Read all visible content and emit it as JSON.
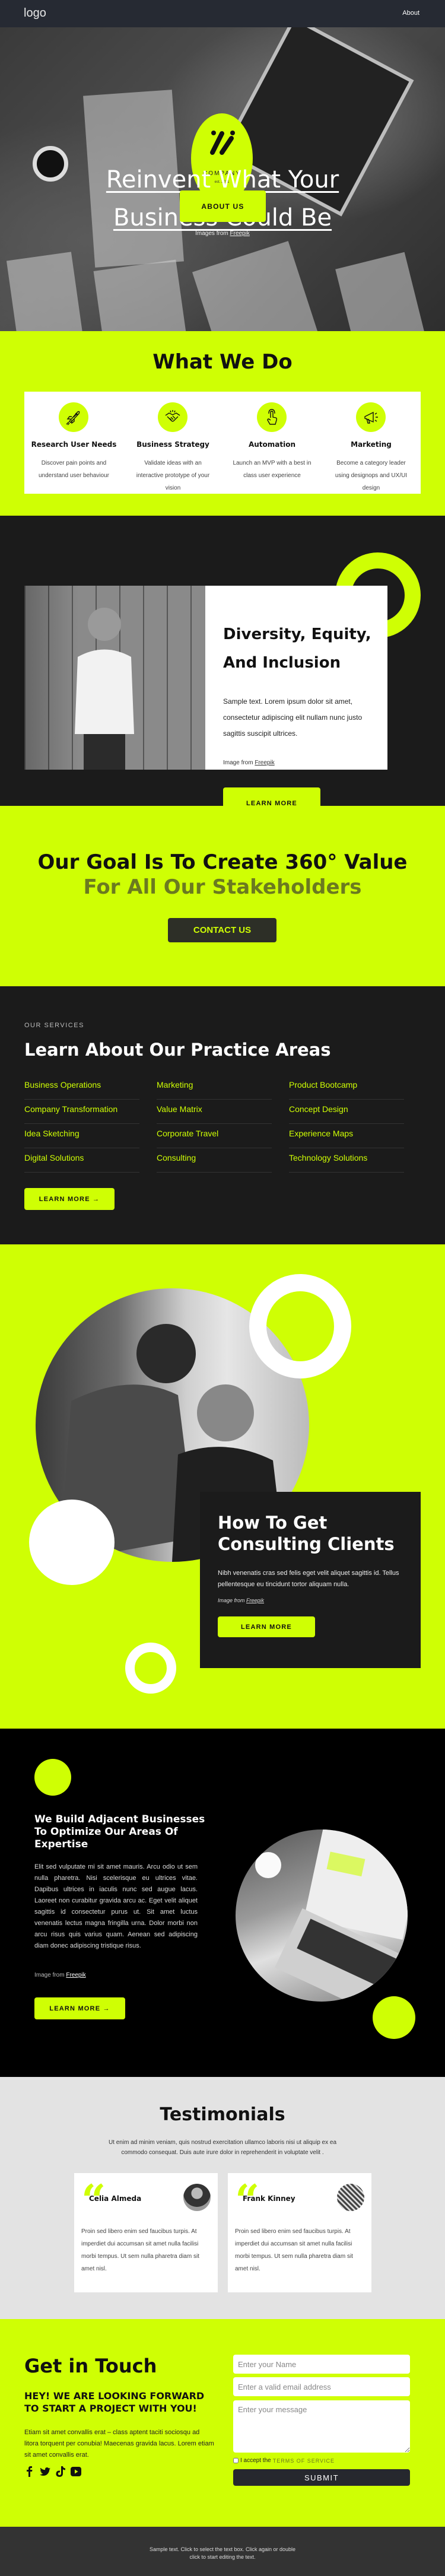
{
  "header": {
    "logo": "logo",
    "nav": [
      {
        "label": "About"
      }
    ]
  },
  "hero": {
    "badge": {
      "name": "COMPANY",
      "est": "est. 2021"
    },
    "title_line1": "Reinvent What Your",
    "title_line2": "Business Could Be",
    "button": "ABOUT US",
    "credit_prefix": "Images from ",
    "credit_link": "Freepik"
  },
  "what_we_do": {
    "title": "What We Do",
    "items": [
      {
        "icon": "rocket-icon",
        "title": "Research User Needs",
        "desc": "Discover pain points and understand user behaviour"
      },
      {
        "icon": "handshake-icon",
        "title": "Business Strategy",
        "desc": "Validate ideas with an interactive prototype of your vision"
      },
      {
        "icon": "touch-icon",
        "title": "Automation",
        "desc": "Launch an MVP with a best in class user experience"
      },
      {
        "icon": "megaphone-icon",
        "title": "Marketing",
        "desc": "Become a category leader using designops and UX/UI design"
      }
    ]
  },
  "diversity": {
    "title": "Diversity, Equity, And Inclusion",
    "text": "Sample text. Lorem ipsum dolor sit amet, consectetur adipiscing elit nullam nunc justo sagittis suscipit ultrices.",
    "credit_prefix": "Image from ",
    "credit_link": "Freepik",
    "button": "LEARN MORE"
  },
  "goal": {
    "line1": "Our Goal Is To Create 360° Value",
    "line2": "For All Our Stakeholders",
    "button": "CONTACT US"
  },
  "practice": {
    "eyebrow": "OUR SERVICES",
    "title": "Learn About Our Practice Areas",
    "columns": [
      [
        "Business Operations",
        "Company Transformation",
        "Idea Sketching",
        "Digital Solutions"
      ],
      [
        "Marketing",
        "Value Matrix",
        "Corporate Travel",
        "Consulting"
      ],
      [
        "Product Bootcamp",
        "Concept Design",
        "Experience Maps",
        "Technology Solutions"
      ]
    ],
    "button": "LEARN MORE →"
  },
  "consulting": {
    "title": "How To Get Consulting Clients",
    "text": "Nibh venenatis cras sed felis eget velit aliquet sagittis id. Tellus pellentesque eu tincidunt tortor aliquam nulla.",
    "credit_prefix": "Image from ",
    "credit_link": "Freepik",
    "button": "LEARN MORE"
  },
  "adjacent": {
    "title": "We Build Adjacent Businesses To Optimize Our Areas Of Expertise",
    "text": "Elit sed vulputate mi sit amet mauris. Arcu odio ut sem nulla pharetra. Nisi scelerisque eu ultrices vitae. Dapibus ultrices in iaculis nunc sed augue lacus. Laoreet non curabitur gravida arcu ac. Eget velit aliquet sagittis id consectetur purus ut. Sit amet luctus venenatis lectus magna fringilla urna. Dolor morbi non arcu risus quis varius quam. Aenean sed adipiscing diam donec adipiscing tristique risus.",
    "credit_prefix": "Image from ",
    "credit_link": "Freepik",
    "button": "LEARN MORE →"
  },
  "testimonials": {
    "title": "Testimonials",
    "subtitle": "Ut enim ad minim veniam, quis nostrud exercitation ullamco laboris nisi ut aliquip ex ea commodo consequat. Duis aute irure dolor in reprehenderit in voluptate velit .",
    "items": [
      {
        "name": "Celia Almeda",
        "text": "Proin sed libero enim sed faucibus turpis. At imperdiet dui accumsan sit amet nulla facilisi morbi tempus. Ut sem nulla pharetra diam sit amet nisl."
      },
      {
        "name": "Frank Kinney",
        "text": "Proin sed libero enim sed faucibus turpis. At imperdiet dui accumsan sit amet nulla facilisi morbi tempus. Ut sem nulla pharetra diam sit amet nisl."
      }
    ]
  },
  "contact": {
    "title": "Get in Touch",
    "subtitle": "HEY! WE ARE LOOKING FORWARD TO START A PROJECT WITH YOU!",
    "text": "Etiam sit amet convallis erat – class aptent taciti sociosqu ad litora torquent per conubia! Maecenas gravida lacus. Lorem etiam sit amet convallis erat.",
    "socials": [
      "facebook-icon",
      "twitter-icon",
      "tiktok-icon",
      "youtube-icon"
    ],
    "form": {
      "name_placeholder": "Enter your Name",
      "name_value": "",
      "email_placeholder": "Enter a valid email address",
      "email_value": "",
      "message_placeholder": "Enter your message",
      "message_value": "",
      "terms_prefix": "I accept the ",
      "terms_link": "TERMS OF SERVICE",
      "terms_checked": false,
      "submit": "SUBMIT"
    }
  },
  "footer": {
    "text": "Sample text. Click to select the text box. Click again or double click to start editing the text."
  },
  "colors": {
    "accent": "#cfff04",
    "dark": "#1b1b1b",
    "header": "#262a33",
    "olive": "#6b7a20",
    "footer": "#333333",
    "light_gray": "#e3e3e3"
  }
}
